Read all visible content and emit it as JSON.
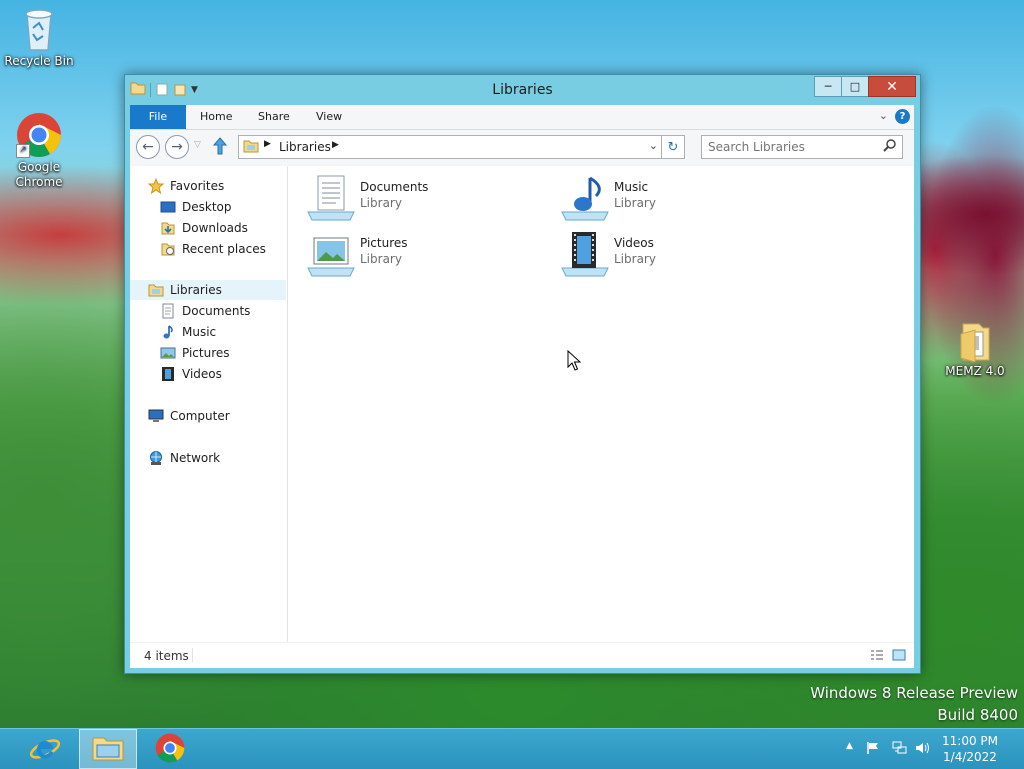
{
  "desktop": {
    "icons": [
      {
        "label": "Recycle Bin",
        "icon": "recycle-bin-icon"
      },
      {
        "label": "Google Chrome",
        "icon": "chrome-icon"
      },
      {
        "label": "MEMZ 4.0",
        "icon": "folder-icon"
      }
    ],
    "watermark": {
      "line1": "Windows 8 Release Preview",
      "line2": "Build 8400"
    }
  },
  "window": {
    "title": "Libraries",
    "controls": {
      "minimize": "minimize-icon",
      "maximize": "maximize-icon",
      "close": "close-icon"
    },
    "ribbon_tabs": [
      "File",
      "Home",
      "Share",
      "View"
    ],
    "address": {
      "crumb": "Libraries"
    },
    "search": {
      "placeholder": "Search Libraries"
    },
    "nav_pane": {
      "favorites": {
        "label": "Favorites",
        "items": [
          "Desktop",
          "Downloads",
          "Recent places"
        ]
      },
      "libraries": {
        "label": "Libraries",
        "items": [
          "Documents",
          "Music",
          "Pictures",
          "Videos"
        ]
      },
      "computer": "Computer",
      "network": "Network"
    },
    "libraries": [
      {
        "name": "Documents",
        "type": "Library",
        "icon": "documents-library-icon"
      },
      {
        "name": "Music",
        "type": "Library",
        "icon": "music-library-icon"
      },
      {
        "name": "Pictures",
        "type": "Library",
        "icon": "pictures-library-icon"
      },
      {
        "name": "Videos",
        "type": "Library",
        "icon": "videos-library-icon"
      }
    ],
    "status": "4 items"
  },
  "taskbar": {
    "apps": [
      {
        "name": "Internet Explorer",
        "icon": "internet-explorer-icon"
      },
      {
        "name": "File Explorer",
        "icon": "file-explorer-icon",
        "active": true
      },
      {
        "name": "Google Chrome",
        "icon": "chrome-icon"
      }
    ],
    "clock": {
      "time": "11:00 PM",
      "date": "1/4/2022"
    }
  },
  "colors": {
    "accent": "#1979ca",
    "window_frame": "#79cde3",
    "taskbar": "#2b93bd",
    "close": "#c74c3c"
  }
}
